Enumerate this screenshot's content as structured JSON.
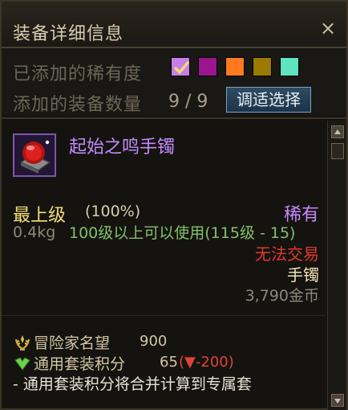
{
  "window": {
    "title": "装备详细信息",
    "close_label": "×"
  },
  "filter": {
    "rarity_label": "已添加的稀有度",
    "count_label": "添加的装备数量",
    "count_value": "9 / 9",
    "adjust_button": "调适选择",
    "swatches": [
      {
        "name": "rarity-swatch-purple-checked",
        "color": "#c77ee8",
        "checked": true
      },
      {
        "name": "rarity-swatch-magenta",
        "color": "#99168f"
      },
      {
        "name": "rarity-swatch-orange",
        "color": "#ff7a1f"
      },
      {
        "name": "rarity-swatch-olive",
        "color": "#9a7a00"
      },
      {
        "name": "rarity-swatch-teal",
        "color": "#5fe3c0"
      }
    ]
  },
  "item": {
    "name": "起始之鸣手镯",
    "icon": "bracelet-icon",
    "grade": "最上级",
    "grade_percent": "(100%)",
    "rarity": "稀有",
    "weight": "0.4kg",
    "level_requirement": "100级以上可以使用(115级 - 15)",
    "trade": "无法交易",
    "slot": "手镯",
    "price": "3,790金币"
  },
  "stats": {
    "fame_label": "冒险家名望",
    "fame_value": "900",
    "set_label": "通用套装积分",
    "set_value": "65",
    "set_diff": "(▼-200)",
    "note": "- 通用套装积分将合并计算到专属套"
  }
}
